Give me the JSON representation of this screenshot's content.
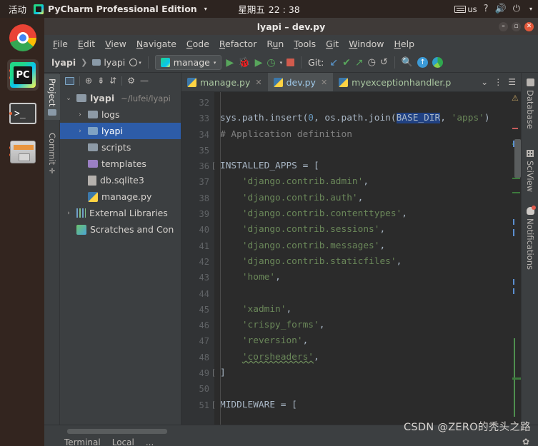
{
  "gnome": {
    "activities": "活动",
    "app_name": "PyCharm Professional Edition",
    "app_caret": "▾",
    "weekday": "星期五",
    "time": "22 : 38",
    "keyboard_layout": "us",
    "help_icon": "?",
    "volume_icon": "🔊",
    "power_icon": "⏻",
    "power_caret": "▾"
  },
  "dock": {
    "items": [
      {
        "name": "google-chrome",
        "label": "Google Chrome"
      },
      {
        "name": "pycharm",
        "label": "PyCharm Professional Edition"
      },
      {
        "name": "terminal",
        "label": "Terminal"
      },
      {
        "name": "files",
        "label": "Files"
      }
    ]
  },
  "window": {
    "title": "lyapi – dev.py",
    "minimize": "–",
    "maximize": "▫",
    "close": "✕"
  },
  "menu": {
    "items": [
      {
        "pre": "",
        "key": "F",
        "post": "ile"
      },
      {
        "pre": "",
        "key": "E",
        "post": "dit"
      },
      {
        "pre": "",
        "key": "V",
        "post": "iew"
      },
      {
        "pre": "",
        "key": "N",
        "post": "avigate"
      },
      {
        "pre": "",
        "key": "C",
        "post": "ode"
      },
      {
        "pre": "",
        "key": "R",
        "post": "efactor"
      },
      {
        "pre": "R",
        "key": "u",
        "post": "n"
      },
      {
        "pre": "",
        "key": "T",
        "post": "ools"
      },
      {
        "pre": "",
        "key": "G",
        "post": "it"
      },
      {
        "pre": "",
        "key": "W",
        "post": "indow"
      },
      {
        "pre": "",
        "key": "H",
        "post": "elp"
      }
    ]
  },
  "toolbar": {
    "breadcrumb_project": "lyapi",
    "breadcrumb_sep": "❯",
    "breadcrumb_module": "lyapi",
    "run_config": "manage",
    "run_config_caret": "▾",
    "run_icon": "▶",
    "debug_icon": "🐞",
    "run_coverage_icon": "▶",
    "profile_icon": "◷",
    "profile_caret": "▾",
    "stop_icon": "■",
    "git_label": "Git:",
    "git_update_icon": "↙",
    "git_commit_icon": "✔",
    "git_push_icon": "↗",
    "git_history_icon": "◷",
    "git_rollback_icon": "↺",
    "search_icon": "🔍",
    "updates_icon": "↑",
    "ide_icon": "◕"
  },
  "left_tool_window": {
    "tabs": [
      {
        "label": "Project",
        "icon": "folder-icon",
        "selected": true
      },
      {
        "label": "Commit",
        "icon": "commit-icon",
        "selected": false
      }
    ]
  },
  "project_pane": {
    "toolbar_icons": [
      "project-view-icon",
      "locate-icon",
      "collapse-all-icon",
      "expand-all-icon",
      "settings-gear-icon",
      "hide-icon"
    ],
    "tree": [
      {
        "indent": 0,
        "arrow": "⌄",
        "icon": "folder",
        "label": "lyapi",
        "bold": true,
        "path": "~/lufei/lyapi",
        "selected": false
      },
      {
        "indent": 1,
        "arrow": "›",
        "icon": "folder",
        "label": "logs",
        "bold": false,
        "path": "",
        "selected": false
      },
      {
        "indent": 1,
        "arrow": "›",
        "icon": "folder-src",
        "label": "lyapi",
        "bold": false,
        "path": "",
        "selected": true
      },
      {
        "indent": 1,
        "arrow": "",
        "icon": "folder",
        "label": "scripts",
        "bold": false,
        "path": "",
        "selected": false
      },
      {
        "indent": 1,
        "arrow": "",
        "icon": "folder-tpl",
        "label": "templates",
        "bold": false,
        "path": "",
        "selected": false
      },
      {
        "indent": 1,
        "arrow": "",
        "icon": "file",
        "label": "db.sqlite3",
        "bold": false,
        "path": "",
        "selected": false
      },
      {
        "indent": 1,
        "arrow": "",
        "icon": "python",
        "label": "manage.py",
        "bold": false,
        "path": "",
        "selected": false
      },
      {
        "indent": 0,
        "arrow": "›",
        "icon": "library",
        "label": "External Libraries",
        "bold": false,
        "path": "",
        "selected": false
      },
      {
        "indent": 0,
        "arrow": "",
        "icon": "scratch",
        "label": "Scratches and Con",
        "bold": false,
        "path": "",
        "selected": false
      }
    ]
  },
  "editor_tabs": {
    "tabs": [
      {
        "label": "manage.py",
        "active": false,
        "close": "✕"
      },
      {
        "label": "dev.py",
        "active": true,
        "close": "✕"
      },
      {
        "label": "myexceptionhandler.p",
        "active": false,
        "close": ""
      }
    ],
    "overflow_caret": "⌄",
    "more_icon": "⋮",
    "stack_icon": "☰"
  },
  "editor": {
    "first_line_number": 32,
    "lines": [
      {
        "n": 32,
        "tokens": []
      },
      {
        "n": 33,
        "changed": true,
        "tokens": [
          {
            "t": "sys.path.insert(",
            "c": "def"
          },
          {
            "t": "0",
            "c": "num"
          },
          {
            "t": ", os.path.join(",
            "c": "def"
          },
          {
            "t": "BASE_DIR",
            "c": "sel"
          },
          {
            "t": ", ",
            "c": "def"
          },
          {
            "t": "'apps'",
            "c": "str"
          },
          {
            "t": ")",
            "c": "def"
          }
        ]
      },
      {
        "n": 34,
        "tokens": [
          {
            "t": "# Application definition",
            "c": "com"
          }
        ]
      },
      {
        "n": 35,
        "tokens": []
      },
      {
        "n": 36,
        "fold": "−",
        "tokens": [
          {
            "t": "INSTALLED_APPS = [",
            "c": "def"
          }
        ]
      },
      {
        "n": 37,
        "tokens": [
          {
            "t": "    ",
            "c": "def"
          },
          {
            "t": "'django.contrib.admin'",
            "c": "str"
          },
          {
            "t": ",",
            "c": "def"
          }
        ]
      },
      {
        "n": 38,
        "tokens": [
          {
            "t": "    ",
            "c": "def"
          },
          {
            "t": "'django.contrib.auth'",
            "c": "str"
          },
          {
            "t": ",",
            "c": "def"
          }
        ]
      },
      {
        "n": 39,
        "tokens": [
          {
            "t": "    ",
            "c": "def"
          },
          {
            "t": "'django.contrib.contenttypes'",
            "c": "str"
          },
          {
            "t": ",",
            "c": "def"
          }
        ]
      },
      {
        "n": 40,
        "tokens": [
          {
            "t": "    ",
            "c": "def"
          },
          {
            "t": "'django.contrib.sessions'",
            "c": "str"
          },
          {
            "t": ",",
            "c": "def"
          }
        ]
      },
      {
        "n": 41,
        "tokens": [
          {
            "t": "    ",
            "c": "def"
          },
          {
            "t": "'django.contrib.messages'",
            "c": "str"
          },
          {
            "t": ",",
            "c": "def"
          }
        ]
      },
      {
        "n": 42,
        "tokens": [
          {
            "t": "    ",
            "c": "def"
          },
          {
            "t": "'django.contrib.staticfiles'",
            "c": "str"
          },
          {
            "t": ",",
            "c": "def"
          }
        ]
      },
      {
        "n": 43,
        "changed": true,
        "tokens": [
          {
            "t": "    ",
            "c": "def"
          },
          {
            "t": "'home'",
            "c": "str"
          },
          {
            "t": ",",
            "c": "def"
          }
        ]
      },
      {
        "n": 44,
        "changed": true,
        "tokens": []
      },
      {
        "n": 45,
        "changed": true,
        "tokens": [
          {
            "t": "    ",
            "c": "def"
          },
          {
            "t": "'xadmin'",
            "c": "str"
          },
          {
            "t": ",",
            "c": "def"
          }
        ]
      },
      {
        "n": 46,
        "changed": true,
        "tokens": [
          {
            "t": "    ",
            "c": "def"
          },
          {
            "t": "'crispy_forms'",
            "c": "str"
          },
          {
            "t": ",",
            "c": "def"
          }
        ]
      },
      {
        "n": 47,
        "changed": true,
        "tokens": [
          {
            "t": "    ",
            "c": "def"
          },
          {
            "t": "'reversion'",
            "c": "str"
          },
          {
            "t": ",",
            "c": "def"
          }
        ]
      },
      {
        "n": 48,
        "changed": true,
        "tokens": [
          {
            "t": "    ",
            "c": "def"
          },
          {
            "t": "'corsheaders'",
            "c": "wavy"
          },
          {
            "t": ",",
            "c": "def"
          }
        ]
      },
      {
        "n": 49,
        "changed": true,
        "fold": "−",
        "tokens": [
          {
            "t": "]",
            "c": "def"
          }
        ]
      },
      {
        "n": 50,
        "tokens": []
      },
      {
        "n": 51,
        "fold": "−",
        "tokens": [
          {
            "t": "MIDDLEWARE = [",
            "c": "def"
          }
        ]
      }
    ],
    "warning_icon": "⚠"
  },
  "right_tool_window": {
    "tabs": [
      {
        "label": "Database",
        "icon": "database-icon"
      },
      {
        "label": "SciView",
        "icon": "sciview-grid-icon"
      },
      {
        "label": "Notifications",
        "icon": "notifications-bell-icon"
      }
    ]
  },
  "bottom": {
    "tools": [
      "Terminal",
      "Local",
      "..."
    ],
    "watermark": "CSDN @ZERO的秃头之路",
    "gear_icon": "✿"
  },
  "colors": {
    "accent_selection": "#2d5ca8",
    "editor_bg": "#2b2b2b",
    "panel_bg": "#3c3f41",
    "string_green": "#6a8759",
    "number_blue": "#6897bb",
    "comment_grey": "#808080",
    "ubuntu_dock": "#33251f",
    "close_red": "#e2593b",
    "changed_line_green": "#3a6033"
  }
}
